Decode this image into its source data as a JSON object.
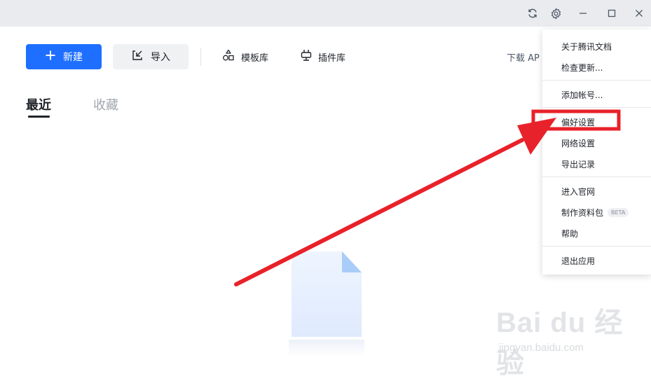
{
  "titlebar": {
    "icons": [
      "sync-icon",
      "settings-icon",
      "minimize-icon",
      "maximize-icon",
      "close-icon"
    ]
  },
  "toolbar": {
    "new_label": "新建",
    "import_label": "导入",
    "templates_label": "模板库",
    "plugins_label": "插件库",
    "download_label": "下载 AP"
  },
  "tabs": {
    "recent": "最近",
    "favorites": "收藏"
  },
  "menu": {
    "about": "关于腾讯文档",
    "check_update": "检查更新...",
    "add_account": "添加帐号...",
    "preferences": "偏好设置",
    "network": "网络设置",
    "export_records": "导出记录",
    "website": "进入官网",
    "make_package": "制作资料包",
    "beta": "BETA",
    "help": "帮助",
    "quit": "退出应用"
  },
  "watermark": {
    "logo": "Bai du 经验",
    "url": "jingyan.baidu.com"
  },
  "colors": {
    "primary": "#1e6fff",
    "annotation_red": "#e8222a",
    "titlebar_bg": "#e9ebee"
  }
}
